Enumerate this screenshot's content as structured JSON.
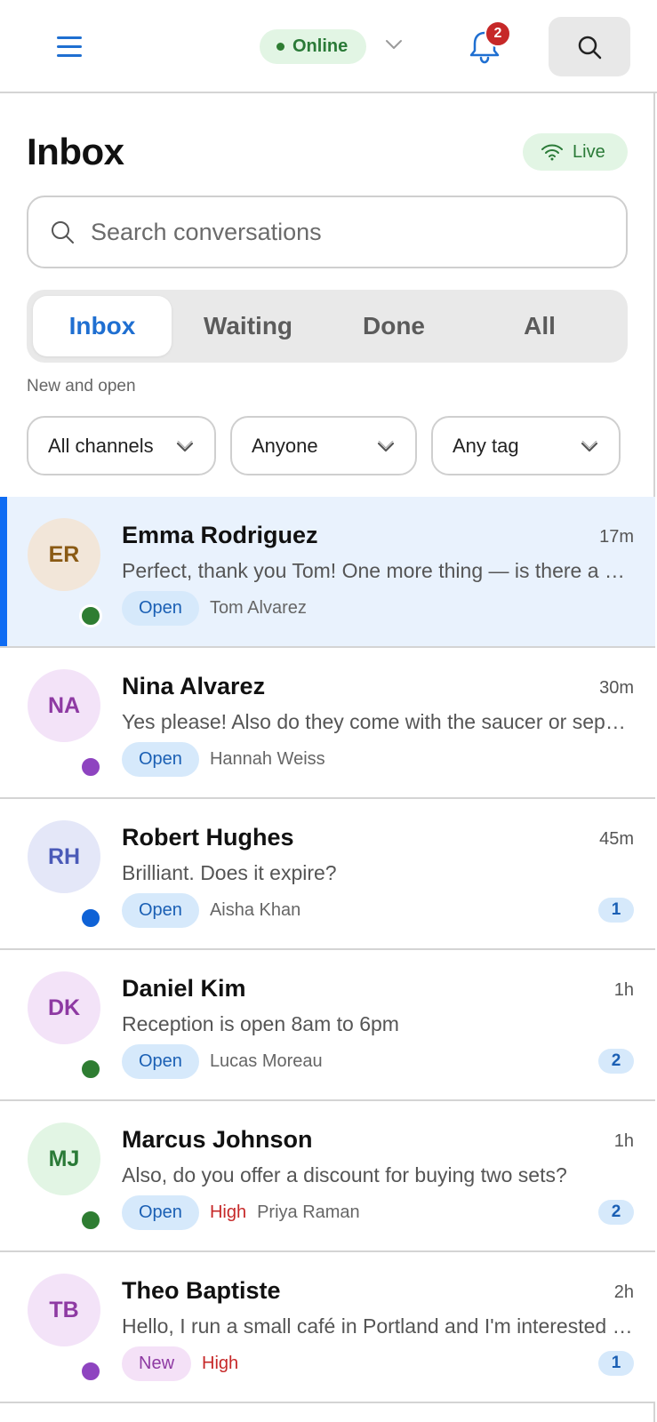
{
  "header": {
    "status_label": "Online",
    "notification_count": "2"
  },
  "inbox": {
    "title": "Inbox",
    "live_label": "Live",
    "search_placeholder": "Search conversations",
    "tabs": [
      {
        "label": "Inbox",
        "active": true
      },
      {
        "label": "Waiting",
        "active": false
      },
      {
        "label": "Done",
        "active": false
      },
      {
        "label": "All",
        "active": false
      }
    ],
    "subtitle": "New and open",
    "filters": [
      {
        "label": "All channels"
      },
      {
        "label": "Anyone"
      },
      {
        "label": "Any tag"
      }
    ]
  },
  "conversations": [
    {
      "initials": "ER",
      "name": "Emma Rodriguez",
      "time": "17m",
      "preview": "Perfect, thank you Tom! One more thing — is there a minimum order?",
      "status": "Open",
      "priority": "",
      "assignee": "Tom Alvarez",
      "count": "",
      "presence_color": "#2e7d32",
      "avatar_bg": "#f2e6d9",
      "avatar_fg": "#8a5a14",
      "selected": true
    },
    {
      "initials": "NA",
      "name": "Nina Alvarez",
      "time": "30m",
      "preview": "Yes please! Also do they come with the saucer or separately?",
      "status": "Open",
      "priority": "",
      "assignee": "Hannah Weiss",
      "count": "",
      "presence_color": "#8e44c0",
      "avatar_bg": "#f3e3f8",
      "avatar_fg": "#8e3aa3",
      "selected": false
    },
    {
      "initials": "RH",
      "name": "Robert Hughes",
      "time": "45m",
      "preview": "Brilliant. Does it expire?",
      "status": "Open",
      "priority": "",
      "assignee": "Aisha Khan",
      "count": "1",
      "presence_color": "#0f62d6",
      "avatar_bg": "#e4e7f8",
      "avatar_fg": "#4b5ab8",
      "selected": false
    },
    {
      "initials": "DK",
      "name": "Daniel Kim",
      "time": "1h",
      "preview": "Reception is open 8am to 6pm",
      "status": "Open",
      "priority": "",
      "assignee": "Lucas Moreau",
      "count": "2",
      "presence_color": "#2e7d32",
      "avatar_bg": "#f3e3f8",
      "avatar_fg": "#8e3aa3",
      "selected": false
    },
    {
      "initials": "MJ",
      "name": "Marcus Johnson",
      "time": "1h",
      "preview": "Also, do you offer a discount for buying two sets?",
      "status": "Open",
      "priority": "High",
      "assignee": "Priya Raman",
      "count": "2",
      "presence_color": "#2e7d32",
      "avatar_bg": "#e2f5e4",
      "avatar_fg": "#2a7a37",
      "selected": false
    },
    {
      "initials": "TB",
      "name": "Theo Baptiste",
      "time": "2h",
      "preview": "Hello, I run a small café in Portland and I'm interested in wholesale pricing",
      "status": "New",
      "priority": "High",
      "assignee": "",
      "count": "1",
      "presence_color": "#8e44c0",
      "avatar_bg": "#f3e3f8",
      "avatar_fg": "#8e3aa3",
      "selected": false
    }
  ],
  "colors": {
    "accent": "#1f6fd1",
    "selected_bar": "#0f6cf3",
    "online_green": "#2a7a37",
    "badge_red": "#c62828"
  },
  "icons": [
    "menu-icon",
    "chevron-down-icon",
    "bell-icon",
    "search-icon",
    "wifi-icon"
  ]
}
